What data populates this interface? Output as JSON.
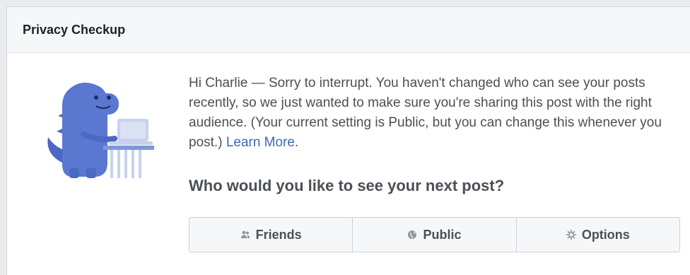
{
  "header": {
    "title": "Privacy Checkup"
  },
  "message": {
    "text": "Hi Charlie — Sorry to interrupt. You haven't changed who can see your posts recently, so we just wanted to make sure you're sharing this post with the right audience. (Your current setting is Public, but you can change this whenever you post.) ",
    "link_text": "Learn More",
    "trailing": "."
  },
  "question": "Who would you like to see your next post?",
  "audience_buttons": [
    {
      "label": "Friends",
      "icon": "friends-icon"
    },
    {
      "label": "Public",
      "icon": "globe-icon"
    },
    {
      "label": "Options",
      "icon": "gear-icon"
    }
  ],
  "colors": {
    "link": "#4267b2",
    "mascot_dark": "#4a68c4",
    "mascot_light": "#7f98d9"
  }
}
